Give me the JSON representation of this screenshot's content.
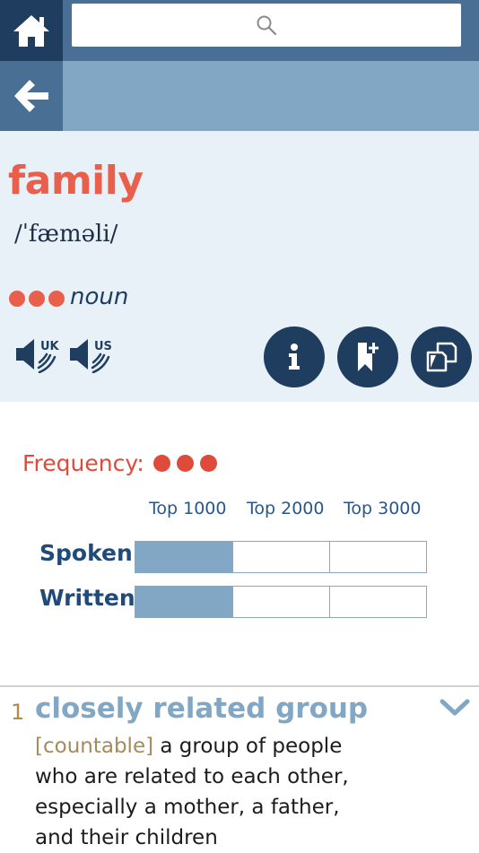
{
  "topbar": {
    "home_icon": "home-icon",
    "search_icon": "search-icon"
  },
  "navbar": {
    "back_icon": "back-arrow-icon"
  },
  "entry": {
    "headword": "family",
    "pronunciation": "/ˈfæməli/",
    "part_of_speech": "noun",
    "frequency_dots": 3,
    "audio_uk": "UK",
    "audio_us": "US",
    "buttons": [
      "info-icon",
      "bookmark-add-icon",
      "copy-icon"
    ]
  },
  "frequency": {
    "label": "Frequency:",
    "columns": [
      "Top 1000",
      "Top 2000",
      "Top 3000"
    ],
    "rows": [
      {
        "label": "Spoken",
        "level": 1
      },
      {
        "label": "Written",
        "level": 1
      }
    ]
  },
  "sense": {
    "number": "1",
    "title": "closely related group",
    "grammar": "[countable]",
    "definition": "a group of people who are related to each other, especially a mother, a father, and their children"
  },
  "colors": {
    "accent": "#e8604c",
    "navy": "#1f3d5e",
    "blue": "#82a7c4"
  }
}
